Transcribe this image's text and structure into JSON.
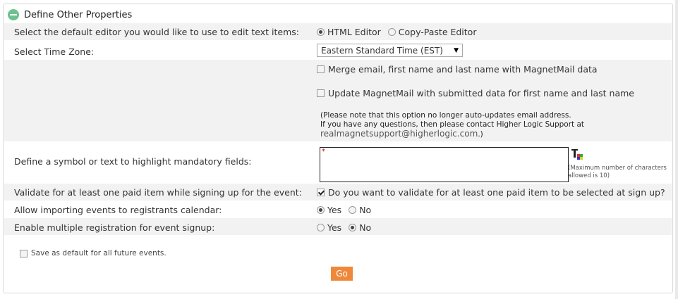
{
  "panel": {
    "title": "Define Other Properties"
  },
  "editor": {
    "label": "Select the default editor you would like to use to edit text items:",
    "options": [
      "HTML Editor",
      "Copy-Paste Editor"
    ],
    "selected": "HTML Editor"
  },
  "timezone": {
    "label": "Select Time Zone:",
    "value": "Eastern Standard Time (EST)"
  },
  "magnet": {
    "merge_label": "Merge email, first name and last name with MagnetMail data",
    "update_label": "Update MagnetMail with submitted data for first name and last name",
    "note_line1": "(Please note that this option no longer auto-updates email address.",
    "note_line2": "If you have any questions, then please contact Higher Logic Support at",
    "note_email": "realmagnetsupport@higherlogic.com",
    "note_end": ".)"
  },
  "mandatory": {
    "label": "Define a symbol or text to highlight mandatory fields:",
    "value": "*",
    "max_note": "(Maximum number of characters allowed is 10)"
  },
  "paid": {
    "label": "Validate for at least one paid item while signing up for the event:",
    "checkbox_label": "Do you want to validate for at least one paid item to be selected at sign up?"
  },
  "import_cal": {
    "label": "Allow importing events to registrants calendar:",
    "yes": "Yes",
    "no": "No"
  },
  "multi_reg": {
    "label": "Enable multiple registration for event signup:",
    "yes": "Yes",
    "no": "No"
  },
  "footer": {
    "save_default_label": "Save as default for all future events.",
    "go_label": "Go"
  },
  "colors": {
    "accent": "#f0883a",
    "collapse_icon": "#6cc18f"
  }
}
